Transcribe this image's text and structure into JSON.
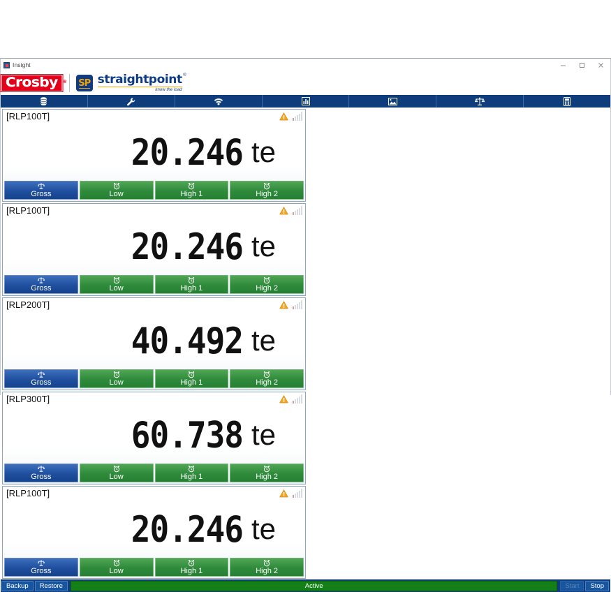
{
  "window": {
    "title": "Insight",
    "app_icon": "app-icon",
    "controls": [
      {
        "name": "minimize",
        "glyph": "minimize-icon"
      },
      {
        "name": "restore",
        "glyph": "restore-icon"
      },
      {
        "name": "close",
        "glyph": "close-icon"
      }
    ]
  },
  "brand": {
    "crosby": "Crosby",
    "crosby_mark": "®",
    "sp_badge": "SP",
    "sp_name": "straightpoint",
    "sp_mark": "®",
    "sp_tagline": "know the load"
  },
  "toolbar": {
    "items": [
      {
        "name": "database-icon",
        "label": "Database"
      },
      {
        "name": "wrench-icon",
        "label": "Tools"
      },
      {
        "name": "wifi-icon",
        "label": "Wireless"
      },
      {
        "name": "bar-chart-icon",
        "label": "Charts"
      },
      {
        "name": "image-icon",
        "label": "Image"
      },
      {
        "name": "scales-icon",
        "label": "Calibration"
      },
      {
        "name": "device-icon",
        "label": "Device"
      }
    ]
  },
  "panels": [
    {
      "title": "[RLP100T]",
      "value": "20.246",
      "unit": "te",
      "warning": true,
      "signal_bars": 5,
      "buttons": [
        {
          "label": "Gross",
          "icon": "scales-icon",
          "color": "blue"
        },
        {
          "label": "Low",
          "icon": "alarm-clock-icon",
          "color": "green"
        },
        {
          "label": "High 1",
          "icon": "alarm-clock-icon",
          "color": "green"
        },
        {
          "label": "High 2",
          "icon": "alarm-clock-icon",
          "color": "green"
        }
      ]
    },
    {
      "title": "[RLP100T]",
      "value": "20.246",
      "unit": "te",
      "warning": true,
      "signal_bars": 5,
      "buttons": [
        {
          "label": "Gross",
          "icon": "scales-icon",
          "color": "blue"
        },
        {
          "label": "Low",
          "icon": "alarm-clock-icon",
          "color": "green"
        },
        {
          "label": "High 1",
          "icon": "alarm-clock-icon",
          "color": "green"
        },
        {
          "label": "High 2",
          "icon": "alarm-clock-icon",
          "color": "green"
        }
      ]
    },
    {
      "title": "[RLP200T]",
      "value": "40.492",
      "unit": "te",
      "warning": true,
      "signal_bars": 5,
      "buttons": [
        {
          "label": "Gross",
          "icon": "scales-icon",
          "color": "blue"
        },
        {
          "label": "Low",
          "icon": "alarm-clock-icon",
          "color": "green"
        },
        {
          "label": "High 1",
          "icon": "alarm-clock-icon",
          "color": "green"
        },
        {
          "label": "High 2",
          "icon": "alarm-clock-icon",
          "color": "green"
        }
      ]
    },
    {
      "title": "[RLP300T]",
      "value": "60.738",
      "unit": "te",
      "warning": true,
      "signal_bars": 5,
      "buttons": [
        {
          "label": "Gross",
          "icon": "scales-icon",
          "color": "blue"
        },
        {
          "label": "Low",
          "icon": "alarm-clock-icon",
          "color": "green"
        },
        {
          "label": "High 1",
          "icon": "alarm-clock-icon",
          "color": "green"
        },
        {
          "label": "High 2",
          "icon": "alarm-clock-icon",
          "color": "green"
        }
      ]
    },
    {
      "title": "[RLP100T]",
      "value": "20.246",
      "unit": "te",
      "warning": true,
      "signal_bars": 5,
      "buttons": [
        {
          "label": "Gross",
          "icon": "scales-icon",
          "color": "blue"
        },
        {
          "label": "Low",
          "icon": "alarm-clock-icon",
          "color": "green"
        },
        {
          "label": "High 1",
          "icon": "alarm-clock-icon",
          "color": "green"
        },
        {
          "label": "High 2",
          "icon": "alarm-clock-icon",
          "color": "green"
        }
      ]
    }
  ],
  "statusbar": {
    "backup": "Backup",
    "restore": "Restore",
    "status": "Active",
    "start": "Start",
    "stop": "Stop",
    "start_enabled": false
  },
  "colors": {
    "toolbar_blue": "#0f3c7a",
    "button_blue": "#1f4f9e",
    "button_green": "#2f8a3c",
    "status_green": "#128017",
    "crosby_red": "#e3001b",
    "sp_navy": "#0d3b85",
    "sp_gold": "#f5a300",
    "warning_amber": "#f5a623"
  }
}
